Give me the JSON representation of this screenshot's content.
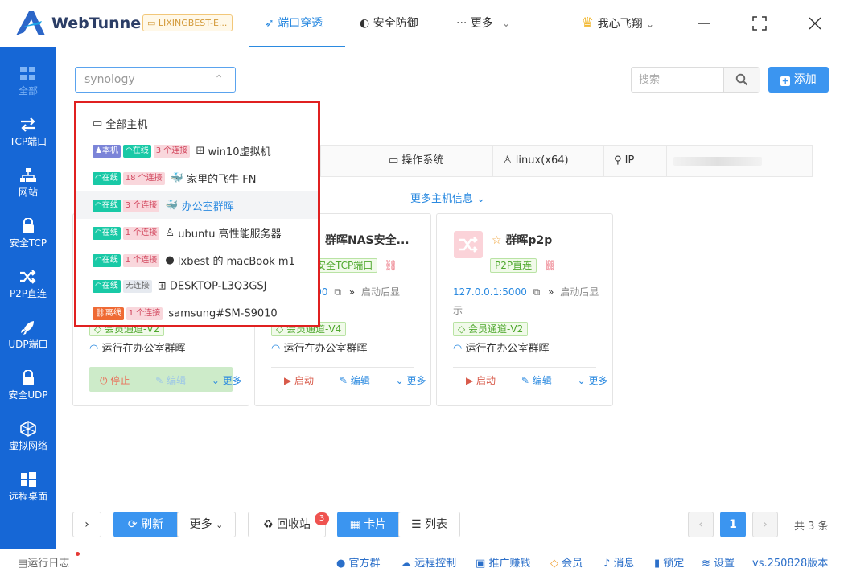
{
  "app": {
    "name": "WebTunnel",
    "host_chip": "LIXINGBEST-E..."
  },
  "topnav": {
    "port": "端口穿透",
    "security": "安全防御",
    "more": "更多"
  },
  "user": {
    "name": "我心飞翔"
  },
  "sidebar": {
    "items": [
      {
        "label": "全部"
      },
      {
        "label": "TCP端口"
      },
      {
        "label": "网站"
      },
      {
        "label": "安全TCP"
      },
      {
        "label": "P2P直连"
      },
      {
        "label": "UDP端口"
      },
      {
        "label": "安全UDP"
      },
      {
        "label": "虚拟网络"
      },
      {
        "label": "远程桌面"
      }
    ]
  },
  "filter": {
    "host_value": "synology"
  },
  "search": {
    "placeholder": "搜索"
  },
  "add_button": "添加",
  "info": {
    "os_label": "操作系统",
    "os_value": "linux(x64)",
    "ip_label": "IP"
  },
  "more_info": "更多主机信息",
  "dropdown": {
    "all_hosts": "全部主机",
    "items": [
      {
        "badges": [
          "本机",
          "在线",
          "3 个连接"
        ],
        "name": "win10虚拟机"
      },
      {
        "badges": [
          "在线",
          "18 个连接"
        ],
        "name": "家里的飞牛 FN"
      },
      {
        "badges": [
          "在线",
          "3 个连接"
        ],
        "name": "办公室群晖"
      },
      {
        "badges": [
          "在线",
          "1 个连接"
        ],
        "name": "ubuntu 高性能服务器"
      },
      {
        "badges": [
          "在线",
          "1 个连接"
        ],
        "name": "lxbest 的 macBook m1"
      },
      {
        "badges": [
          "在线",
          "无连接"
        ],
        "name": "DESKTOP-L3Q3GSJ"
      },
      {
        "badges": [
          "离线",
          "1 个连接"
        ],
        "name": "samsung#SM-S9010"
      }
    ]
  },
  "cards": [
    {
      "channel": "会员通道-V2",
      "running": "运行在办公室群晖",
      "stop": "停止",
      "edit": "编辑",
      "more": "更多"
    },
    {
      "title": "群晖NAS安全...",
      "type_tag": "安全TCP端口",
      "addr": "5000",
      "auto": "启动后显",
      "channel": "会员通道-V4",
      "running": "运行在办公室群晖",
      "start": "启动",
      "edit": "编辑",
      "more": "更多"
    },
    {
      "title": "群晖p2p",
      "type_tag": "P2P直连",
      "addr": "127.0.0.1:5000",
      "auto": "启动后显",
      "auto2": "示",
      "channel": "会员通道-V2",
      "running": "运行在办公室群晖",
      "start": "启动",
      "edit": "编辑",
      "more": "更多"
    }
  ],
  "bottom": {
    "refresh": "刷新",
    "more": "更多",
    "recycle": "回收站",
    "recycle_count": "3",
    "card_view": "卡片",
    "list_view": "列表",
    "page": "1",
    "total": "共 3 条"
  },
  "status_bar": {
    "log": "运行日志",
    "official_group": "官方群",
    "remote": "远程控制",
    "promo": "推广赚钱",
    "member": "会员",
    "messages": "消息",
    "lock": "锁定",
    "settings": "设置",
    "version": "vs.250828版本"
  }
}
